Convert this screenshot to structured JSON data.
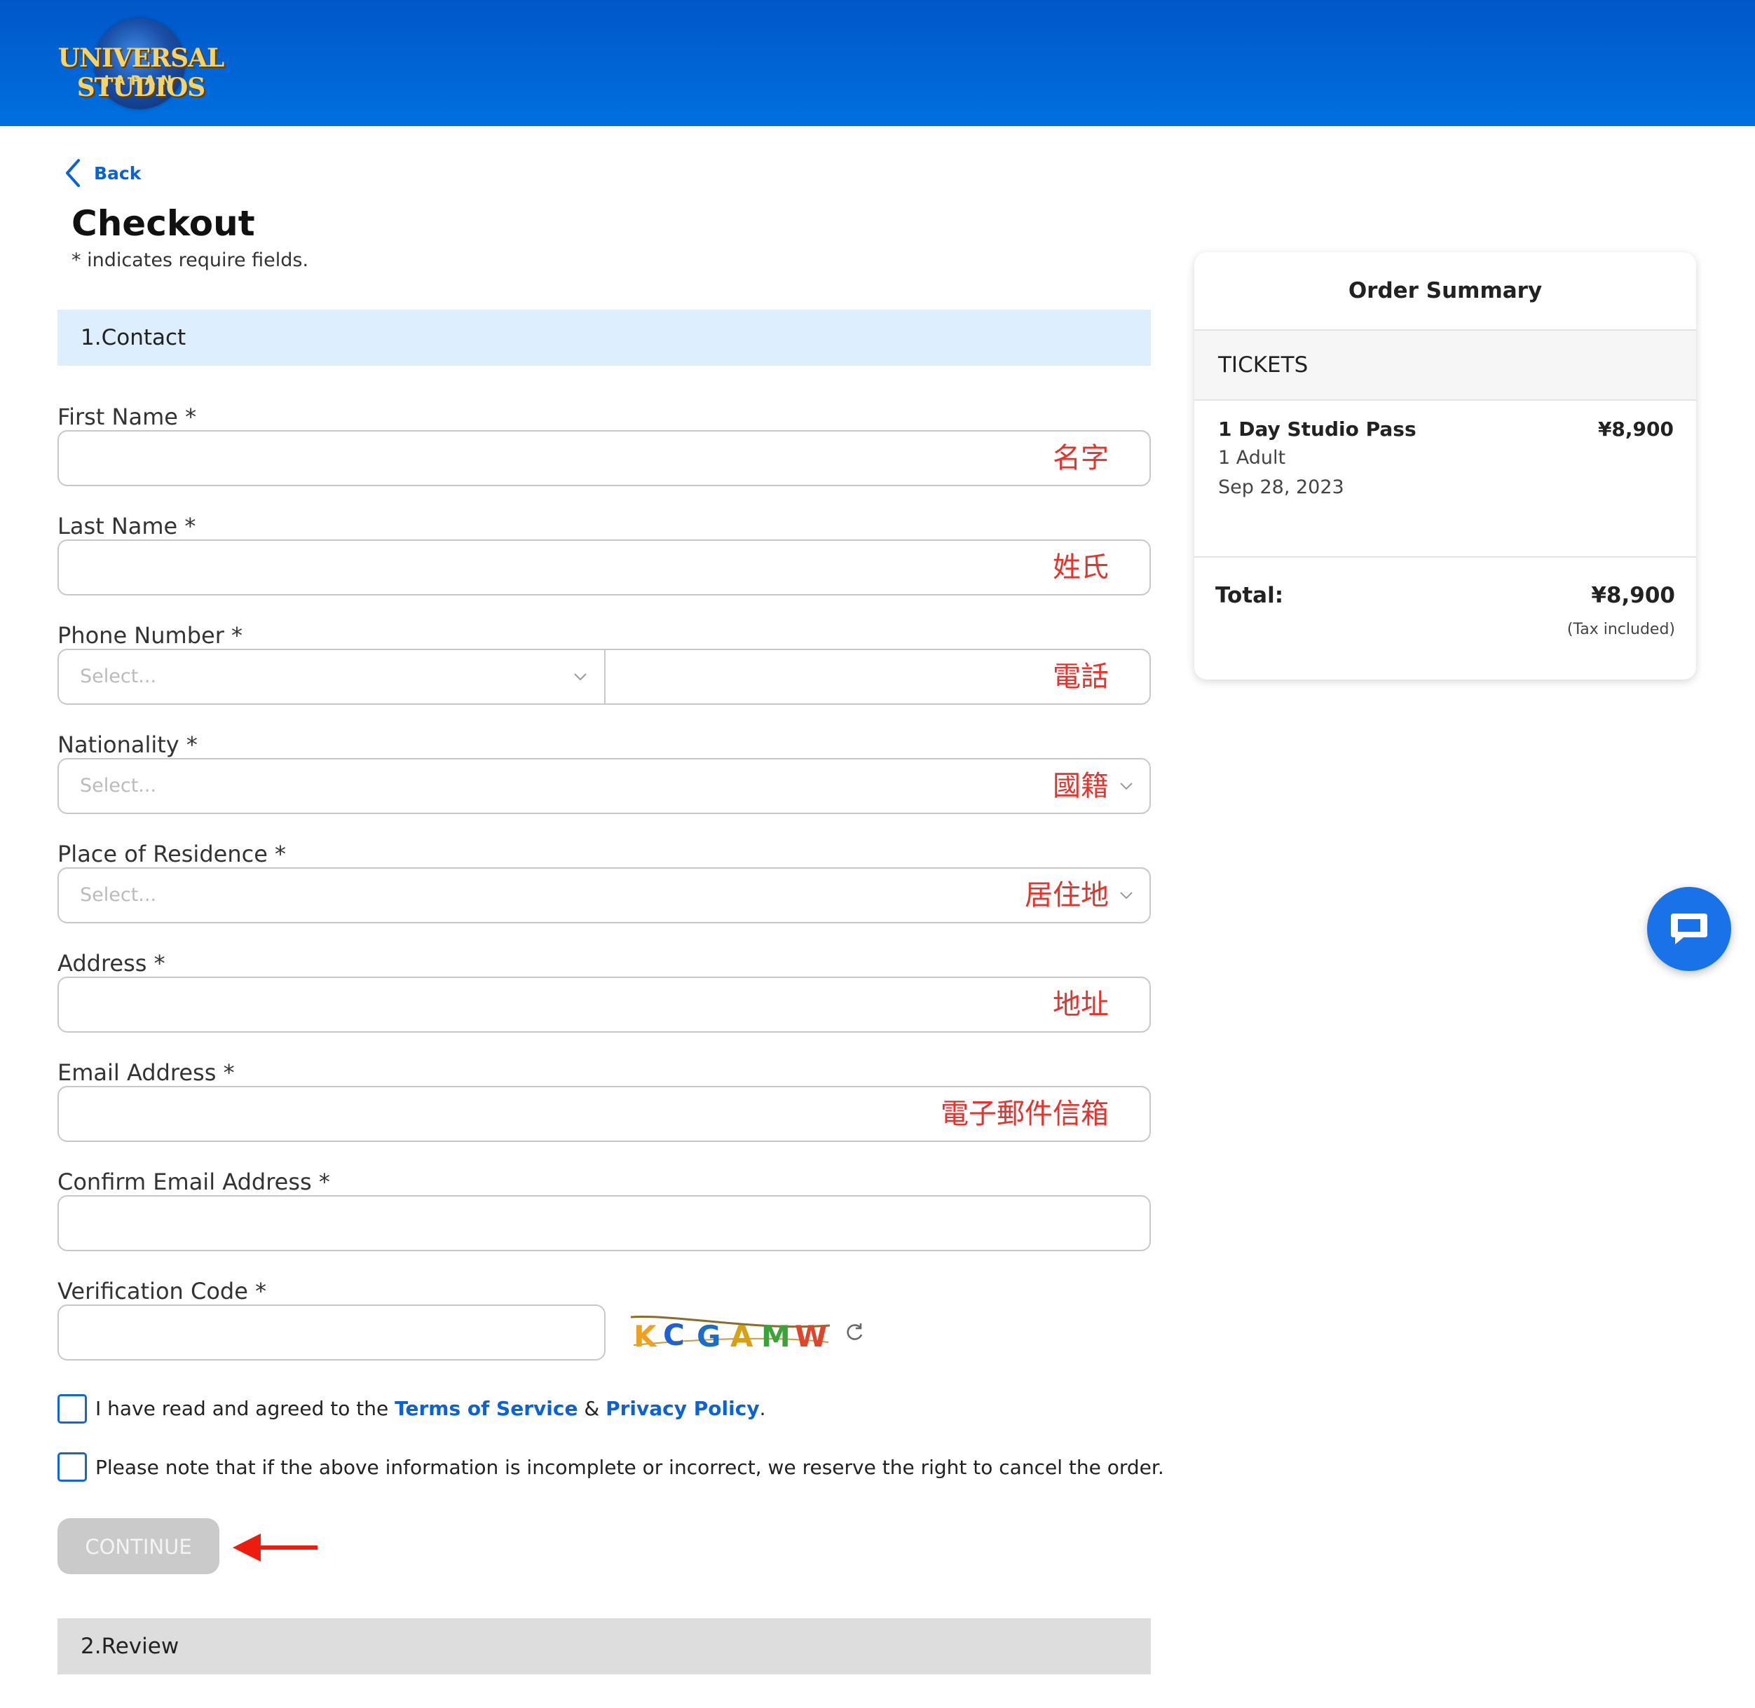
{
  "brand": {
    "logo_text": "UNIVERSAL STUDIOS",
    "logo_sub": "JAPAN",
    "header_color": "#0066d8",
    "accent_color": "#0a63d6",
    "hint_color": "#e8332d"
  },
  "nav": {
    "back_label": "Back"
  },
  "page": {
    "title": "Checkout",
    "subtitle": "* indicates require fields."
  },
  "sections": {
    "contact": "1.Contact",
    "review": "2.Review"
  },
  "form": {
    "first_name": {
      "label": "First Name  *",
      "hint": "名字",
      "value": ""
    },
    "last_name": {
      "label": "Last Name  *",
      "hint": "姓氏",
      "value": ""
    },
    "phone": {
      "label": "Phone Number  *",
      "code_placeholder": "Select...",
      "hint": "電話",
      "value": ""
    },
    "nationality": {
      "label": "Nationality  *",
      "placeholder": "Select...",
      "hint": "國籍"
    },
    "residence": {
      "label": "Place of Residence  *",
      "placeholder": "Select...",
      "hint": "居住地"
    },
    "address": {
      "label": "Address  *",
      "hint": "地址",
      "value": ""
    },
    "email": {
      "label": "Email Address  *",
      "hint": "電子郵件信箱",
      "value": ""
    },
    "confirm_email": {
      "label": "Confirm Email Address  *",
      "value": ""
    },
    "verification": {
      "label": "Verification Code  *",
      "value": "",
      "captcha_chars": [
        "K",
        "C",
        "G",
        "A",
        "M",
        "W"
      ],
      "refresh_icon": "refresh-icon"
    }
  },
  "agreements": {
    "terms": {
      "prefix": "I have read and agreed to the ",
      "terms_link": "Terms of Service",
      "joiner": " & ",
      "privacy_link": "Privacy Policy",
      "suffix": ".",
      "checked": false
    },
    "notice": {
      "text": "Please note that if the above information is incomplete or incorrect, we reserve the right to cancel the order.",
      "checked": false
    }
  },
  "continue_label": "CONTINUE",
  "annotation": {
    "arrow_icon": "red-arrow-left-icon",
    "arrow_color": "#ee1c0e"
  },
  "summary": {
    "title": "Order Summary",
    "tickets_header": "TICKETS",
    "item": {
      "name": "1 Day Studio Pass",
      "price": "¥8,900",
      "quantity": "1 Adult",
      "date": "Sep 28, 2023"
    },
    "total_label": "Total:",
    "total_value": "¥8,900",
    "tax_note": "(Tax included)"
  },
  "chat": {
    "icon": "chat-bubble-icon"
  }
}
